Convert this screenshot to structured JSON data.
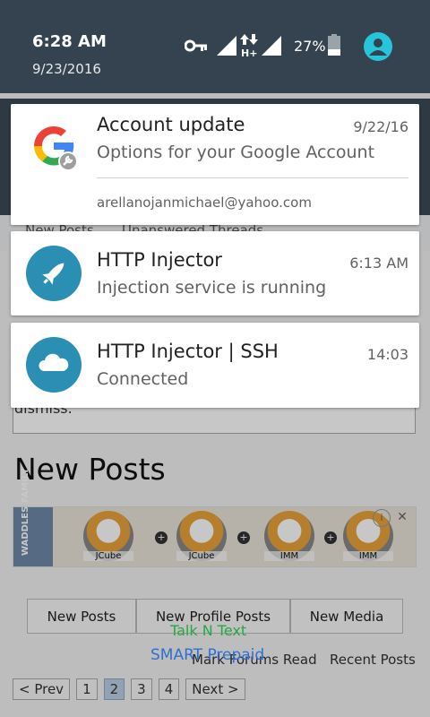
{
  "status": {
    "time": "6:28 AM",
    "date": "9/23/2016",
    "battery_percent": "27%",
    "data_indicator": "H+"
  },
  "background_page": {
    "tab_strip_left": "New Posts",
    "tab_strip_right": "Unanswered Threads",
    "dismiss_text": "dismiss.",
    "heading": "New Posts",
    "banner": {
      "side_label": "WADDLES FAMILY",
      "avatars": [
        "JCube",
        "JCube",
        "IMM",
        "IMM"
      ]
    },
    "tabs": [
      "New Posts",
      "New Profile Posts",
      "New Media"
    ],
    "links": {
      "mark_read": "Mark Forums Read",
      "recent": "Recent Posts"
    },
    "pager": [
      "< Prev",
      "1",
      "2",
      "3",
      "4",
      "Next >"
    ],
    "pager_active_index": 2
  },
  "carrier": {
    "line1": "Talk N Text",
    "line2": "SMART Prepaid"
  },
  "notifications": [
    {
      "app": "google",
      "title": "Account update",
      "time": "9/22/16",
      "text": "Options for your Google Account",
      "subtext": "arellanojanmichael@yahoo.com",
      "icon": "google-g-icon"
    },
    {
      "app": "http-injector",
      "title": "HTTP Injector",
      "time": "6:13 AM",
      "text": "Injection service is running",
      "icon": "rocket-icon",
      "icon_color": "#2b8fb3"
    },
    {
      "app": "http-injector-ssh",
      "title": "HTTP Injector | SSH",
      "time": "14:03",
      "text": "Connected",
      "icon": "cloud-icon",
      "icon_color": "#2b8fb3"
    }
  ],
  "colors": {
    "shade_header": "#34434f",
    "avatar_accent": "#26c6da"
  }
}
